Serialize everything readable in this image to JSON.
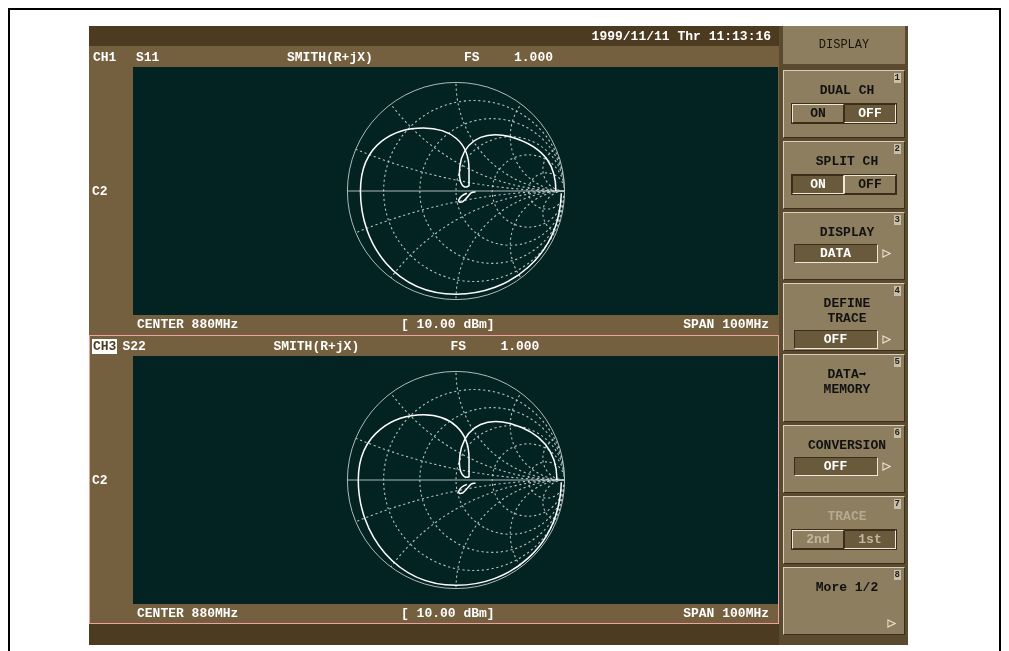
{
  "status_bar": {
    "datetime": "1999/11/11 Thr 11:13:16"
  },
  "channels": [
    {
      "channel": "CH1",
      "active": false,
      "parameter": "S11",
      "format": "SMITH(R+jX)",
      "scale_label": "FS",
      "scale_value": "1.000",
      "side_label": "C2",
      "center": "CENTER 880MHz",
      "power": "[ 10.00 dBm]",
      "span": "SPAN 100MHz"
    },
    {
      "channel": "CH3",
      "active": true,
      "parameter": "S22",
      "format": "SMITH(R+jX)",
      "scale_label": "FS",
      "scale_value": "1.000",
      "side_label": "C2",
      "center": "CENTER 880MHz",
      "power": "[ 10.00 dBm]",
      "span": "SPAN 100MHz"
    }
  ],
  "softkey_menu": {
    "title": "DISPLAY",
    "keys": [
      {
        "number": "1",
        "kind": "toggle",
        "label": "DUAL CH",
        "disabled": false,
        "options": [
          {
            "label": "ON",
            "selected": false
          },
          {
            "label": "OFF",
            "selected": true
          }
        ]
      },
      {
        "number": "2",
        "kind": "toggle",
        "label": "SPLIT CH",
        "disabled": false,
        "options": [
          {
            "label": "ON",
            "selected": true
          },
          {
            "label": "OFF",
            "selected": false
          }
        ]
      },
      {
        "number": "3",
        "kind": "select",
        "label": "DISPLAY",
        "disabled": false,
        "value": "DATA"
      },
      {
        "number": "4",
        "kind": "select",
        "label": "DEFINE TRACE",
        "disabled": false,
        "value": "OFF"
      },
      {
        "number": "5",
        "kind": "action",
        "label": "DATA➡ MEMORY",
        "disabled": false
      },
      {
        "number": "6",
        "kind": "select",
        "label": "CONVERSION",
        "disabled": false,
        "value": "OFF"
      },
      {
        "number": "7",
        "kind": "toggle",
        "label": "TRACE",
        "disabled": true,
        "options": [
          {
            "label": "2nd",
            "selected": false
          },
          {
            "label": "1st",
            "selected": true
          }
        ]
      },
      {
        "number": "8",
        "kind": "more",
        "label": "More 1/2",
        "disabled": false
      }
    ]
  }
}
